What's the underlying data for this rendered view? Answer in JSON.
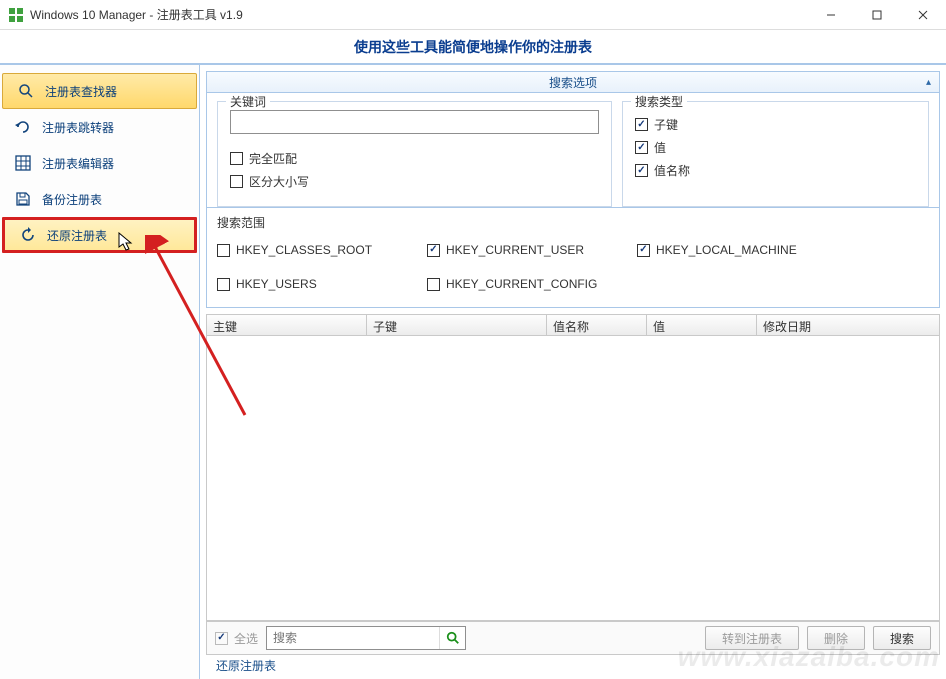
{
  "window": {
    "title": "Windows 10 Manager - 注册表工具 v1.9"
  },
  "banner": "使用这些工具能简便地操作你的注册表",
  "sidebar": {
    "items": [
      {
        "label": "注册表查找器"
      },
      {
        "label": "注册表跳转器"
      },
      {
        "label": "注册表编辑器"
      },
      {
        "label": "备份注册表"
      },
      {
        "label": "还原注册表"
      }
    ]
  },
  "search_panel": {
    "title": "搜索选项",
    "keyword_legend": "关键词",
    "keyword_value": "",
    "exact_match": "完全匹配",
    "case_sensitive": "区分大小写",
    "type_legend": "搜索类型",
    "type_subkey": "子键",
    "type_value": "值",
    "type_valuename": "值名称",
    "scope_legend": "搜索范围",
    "scope_items": {
      "hkcr": "HKEY_CLASSES_ROOT",
      "hkcu": "HKEY_CURRENT_USER",
      "hklm": "HKEY_LOCAL_MACHINE",
      "hku": "HKEY_USERS",
      "hkcc": "HKEY_CURRENT_CONFIG"
    }
  },
  "table": {
    "cols": {
      "c1": "主键",
      "c2": "子键",
      "c3": "值名称",
      "c4": "值",
      "c5": "修改日期"
    }
  },
  "bottom": {
    "select_all": "全选",
    "search_placeholder": "搜索",
    "goto_reg": "转到注册表",
    "delete": "删除",
    "search_btn": "搜索"
  },
  "status": "还原注册表",
  "watermark": "www.xiazaiba.com"
}
